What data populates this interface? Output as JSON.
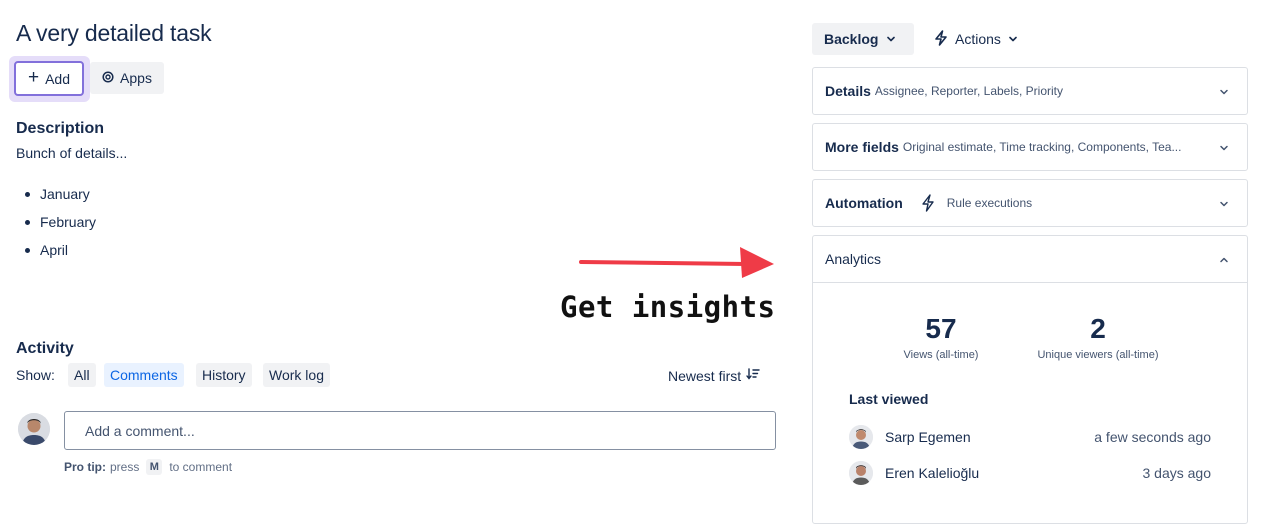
{
  "issue": {
    "title": "A very detailed task"
  },
  "toolbar": {
    "add_label": "Add",
    "apps_label": "Apps"
  },
  "description": {
    "heading": "Description",
    "text": "Bunch of details...",
    "items": [
      "January",
      "February",
      "April"
    ]
  },
  "activity": {
    "heading": "Activity",
    "show_label": "Show:",
    "filters": [
      "All",
      "Comments",
      "History",
      "Work log"
    ],
    "active_filter": "Comments",
    "sort_label": "Newest first",
    "comment_placeholder": "Add a comment...",
    "pro_tip_bold": "Pro tip:",
    "pro_tip_press": "press",
    "pro_tip_key": "M",
    "pro_tip_suffix": "to comment"
  },
  "annotation": {
    "text": "Get insights",
    "arrow_color": "#ef3b47"
  },
  "sidebar": {
    "status_label": "Backlog",
    "actions_label": "Actions",
    "panels": [
      {
        "title": "Details",
        "subtitle": "Assignee, Reporter, Labels, Priority"
      },
      {
        "title": "More fields",
        "subtitle": "Original estimate, Time tracking, Components, Tea..."
      },
      {
        "title": "Automation",
        "subtitle": "Rule executions"
      }
    ],
    "analytics": {
      "title": "Analytics",
      "views_value": "57",
      "views_label": "Views (all-time)",
      "unique_value": "2",
      "unique_label": "Unique viewers (all-time)",
      "last_viewed_heading": "Last viewed",
      "viewers": [
        {
          "name": "Sarp Egemen",
          "when": "a few seconds ago"
        },
        {
          "name": "Eren Kalelioğlu",
          "when": "3 days ago"
        }
      ]
    }
  },
  "colors": {
    "accent_purple": "#8270db",
    "link_blue": "#0c66e4",
    "text": "#172b4d"
  }
}
